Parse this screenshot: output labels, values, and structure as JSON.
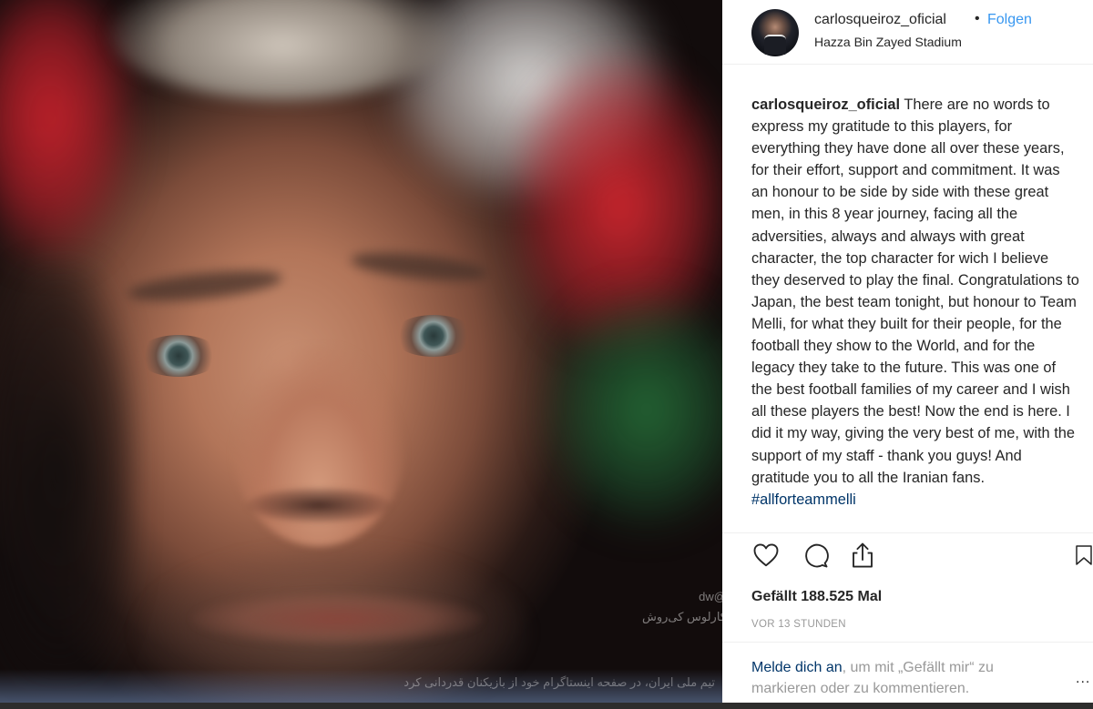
{
  "post": {
    "username": "carlosqueiroz_oficial",
    "separator": "•",
    "follow_label": "Folgen",
    "location": "Hazza Bin Zayed Stadium"
  },
  "caption": {
    "author": "carlosqueiroz_oficial",
    "text": "There are no words to express my gratitude to this players, for everything they have done all over these years, for their effort, support and commitment. It was an honour to be side by side with these great men, in this 8 year journey, facing all the adversities, always and always with great character, the top character for wich I believe they deserved to play the final. Congratulations to Japan, the best team tonight, but honour to Team Melli, for what they built for their people, for the football they show to the World, and for the legacy they take to the future. This was one of the best football families of my career and I wish all these players the best! Now the end is here. I did it my way, giving the very best of me, with the support of my staff - thank you guys! And gratitude you to all the Iranian fans.",
    "hashtag": "#allforteammelli"
  },
  "actions": {
    "like_icon": "heart-icon",
    "comment_icon": "comment-icon",
    "share_icon": "share-icon",
    "save_icon": "bookmark-icon"
  },
  "likes_text": "Gefällt 188.525 Mal",
  "timestamp": "VOR 13 STUNDEN",
  "login": {
    "link": "Melde dich an",
    "rest": ", um mit „Gefällt mir“ zu markieren oder zu kommentieren.",
    "more": "..."
  },
  "photo": {
    "watermark_line1": "@dw",
    "watermark_line2": "کارلوس کی‌روش",
    "overlay_caption": "تیم ملی ایران، در صفحه اینستاگرام خود از بازیکنان قدردانی کرد"
  },
  "colors": {
    "link_blue": "#3897f0",
    "hashtag_navy": "#003569",
    "text_primary": "#262626",
    "text_muted": "#999999"
  }
}
